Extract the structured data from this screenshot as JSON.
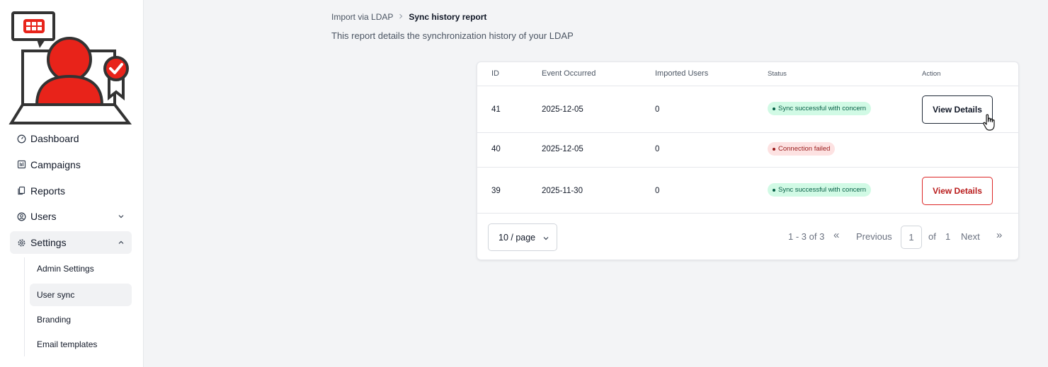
{
  "sidebar": {
    "items": [
      {
        "label": "Dashboard",
        "icon": "gauge-icon"
      },
      {
        "label": "Campaigns",
        "icon": "chart-icon"
      },
      {
        "label": "Reports",
        "icon": "document-icon"
      },
      {
        "label": "Users",
        "icon": "user-circle-icon"
      },
      {
        "label": "Settings",
        "icon": "gear-icon"
      }
    ],
    "settings_children": [
      {
        "label": "Admin Settings"
      },
      {
        "label": "User sync"
      },
      {
        "label": "Branding"
      },
      {
        "label": "Email templates"
      }
    ]
  },
  "breadcrumb": {
    "parent": "Import via LDAP",
    "current": "Sync history report"
  },
  "subtitle": "This report details the synchronization history of your LDAP",
  "table": {
    "headers": {
      "id": "ID",
      "event": "Event Occurred",
      "imported": "Imported Users",
      "status": "Status",
      "action": "Action"
    },
    "rows": [
      {
        "id": "41",
        "event": "2025-12-05",
        "imported": "0",
        "status": "Sync successful with concern",
        "action": "View Details"
      },
      {
        "id": "40",
        "event": "2025-12-05",
        "imported": "0",
        "status": "Connection failed",
        "action": ""
      },
      {
        "id": "39",
        "event": "2025-11-30",
        "imported": "0",
        "status": "Sync successful with concern",
        "action": "View Details"
      }
    ]
  },
  "pagination": {
    "page_size": "10 / page",
    "range": "1 - 3 of 3",
    "first": "«",
    "previous": "Previous",
    "current_page": "1",
    "of": "of",
    "total_pages": "1",
    "next": "Next",
    "last": "»"
  },
  "colors": {
    "brand_red": "#e8231a",
    "success_bg": "#d1fae5",
    "success_text": "#065f46",
    "fail_bg": "#fde2e2",
    "fail_text": "#991b1b"
  }
}
